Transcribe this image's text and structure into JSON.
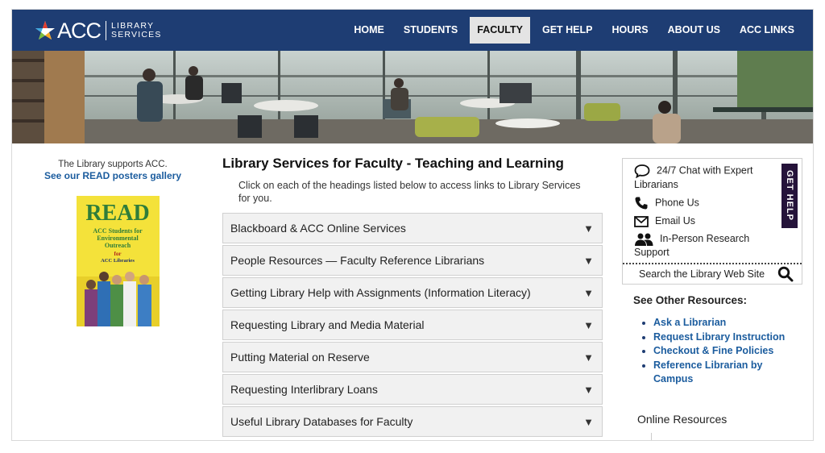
{
  "header": {
    "logo_text": "ACC",
    "logo_sub_line1": "LIBRARY",
    "logo_sub_line2": "SERVICES",
    "nav": [
      {
        "label": "HOME"
      },
      {
        "label": "STUDENTS"
      },
      {
        "label": "FACULTY",
        "active": true
      },
      {
        "label": "GET HELP"
      },
      {
        "label": "HOURS"
      },
      {
        "label": "ABOUT US"
      },
      {
        "label": "ACC LINKS"
      }
    ]
  },
  "left": {
    "supports_text": "The Library supports ACC.",
    "posters_link": "See our READ posters gallery",
    "poster": {
      "title": "READ",
      "line1": "ACC Students for",
      "line2": "Environmental",
      "line3": "Outreach",
      "line4": "for",
      "line5": "ACC Libraries"
    }
  },
  "main": {
    "title": "Library Services for Faculty - Teaching and Learning",
    "intro": "Click on each of the headings listed below to access links to Library Services for you.",
    "sections": [
      "Blackboard & ACC Online Services",
      "People Resources — Faculty Reference Librarians",
      "Getting Library Help with Assignments (Information Literacy)",
      "Requesting Library and Media Material",
      "Putting Material on Reserve",
      "Requesting Interlibrary Loans",
      "Useful Library Databases for Faculty"
    ],
    "arrow_glyph": "▼"
  },
  "help": {
    "chat_line1": "24/7 Chat with Expert",
    "chat_line2": "Librarians",
    "phone": "Phone Us",
    "email": "Email Us",
    "inperson_line1": "In-Person Research",
    "inperson_line2": "Support",
    "tab_label": "GET HELP",
    "search_placeholder": "Search the Library Web Site"
  },
  "other": {
    "title": "See Other Resources:",
    "links": [
      "Ask a Librarian",
      "Request Library Instruction",
      "Checkout & Fine Policies",
      "Reference Librarian by Campus"
    ]
  },
  "online": {
    "title": "Online Resources"
  },
  "colors": {
    "header_bg": "#1e3d73",
    "link": "#1b5c9e",
    "help_tab": "#25133a",
    "poster_bg": "#f4e23a"
  }
}
